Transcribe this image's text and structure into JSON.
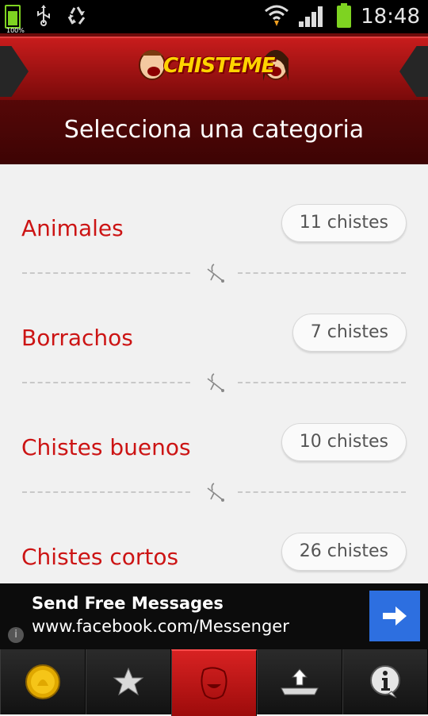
{
  "status_bar": {
    "time": "18:48",
    "battery_small_label": "100%"
  },
  "header": {
    "logo_text": "CHISTEME",
    "title": "Selecciona una categoria"
  },
  "categories": [
    {
      "name": "Animales",
      "count": "11 chistes"
    },
    {
      "name": "Borrachos",
      "count": "7 chistes"
    },
    {
      "name": "Chistes buenos",
      "count": "10 chistes"
    },
    {
      "name": "Chistes cortos",
      "count": "26 chistes"
    }
  ],
  "ad": {
    "title": "Send Free Messages",
    "url": "www.facebook.com/Messenger",
    "info_icon": "i"
  },
  "tabs": [
    {
      "icon": "coin-icon"
    },
    {
      "icon": "star-icon"
    },
    {
      "icon": "laughing-face-icon",
      "active": true
    },
    {
      "icon": "upload-icon"
    },
    {
      "icon": "info-icon"
    }
  ],
  "colors": {
    "accent_red": "#cc1414",
    "ad_button_blue": "#2d6fe0"
  }
}
